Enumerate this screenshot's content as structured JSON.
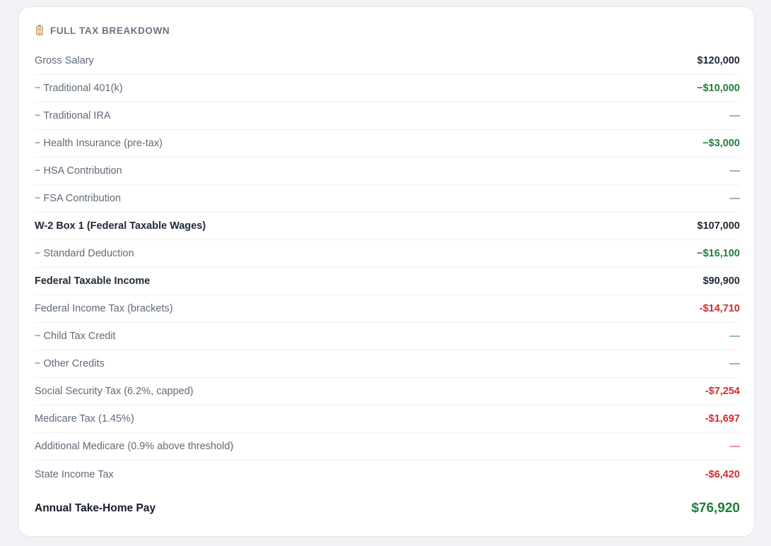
{
  "header": {
    "icon": "clipboard-icon",
    "title": "FULL TAX BREAKDOWN"
  },
  "colors": {
    "positive": "#1f7f3b",
    "negative": "#d42b2b",
    "neutral": "#1f2a37"
  },
  "rows": [
    {
      "label": "Gross Salary",
      "value": "$120,000"
    },
    {
      "label": "− Traditional 401(k)",
      "value": "−$10,000"
    },
    {
      "label": "− Traditional IRA",
      "value": "—"
    },
    {
      "label": "− Health Insurance (pre-tax)",
      "value": "−$3,000"
    },
    {
      "label": "− HSA Contribution",
      "value": "—"
    },
    {
      "label": "− FSA Contribution",
      "value": "—"
    },
    {
      "label": "W-2 Box 1 (Federal Taxable Wages)",
      "value": "$107,000"
    },
    {
      "label": "− Standard Deduction",
      "value": "−$16,100"
    },
    {
      "label": "Federal Taxable Income",
      "value": "$90,900"
    },
    {
      "label": "Federal Income Tax (brackets)",
      "value": "-$14,710"
    },
    {
      "label": "− Child Tax Credit",
      "value": "—"
    },
    {
      "label": "− Other Credits",
      "value": "—"
    },
    {
      "label": "Social Security Tax (6.2%, capped)",
      "value": "-$7,254"
    },
    {
      "label": "Medicare Tax (1.45%)",
      "value": "-$1,697"
    },
    {
      "label": "Additional Medicare (0.9% above threshold)",
      "value": "—"
    },
    {
      "label": "State Income Tax",
      "value": "-$6,420"
    }
  ],
  "total": {
    "label": "Annual Take-Home Pay",
    "value": "$76,920"
  }
}
